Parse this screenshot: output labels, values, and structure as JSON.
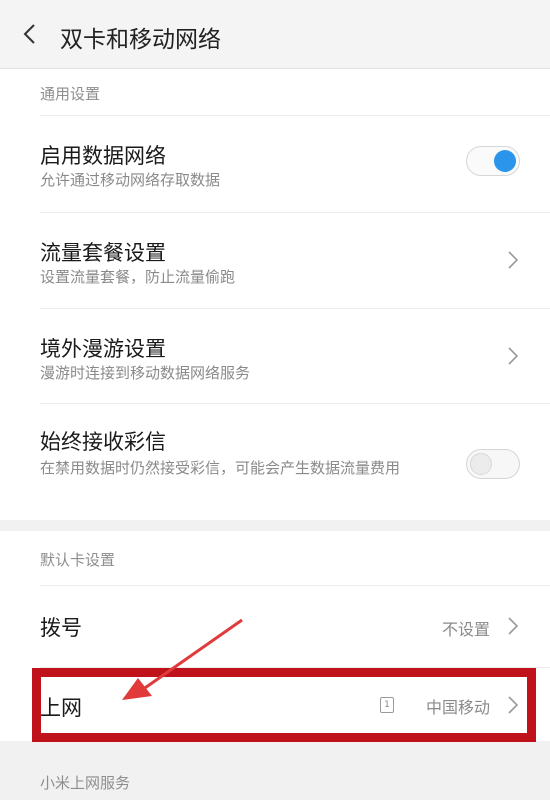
{
  "header": {
    "title": "双卡和移动网络"
  },
  "general": {
    "section_label": "通用设置",
    "items": [
      {
        "title": "启用数据网络",
        "subtitle": "允许通过移动网络存取数据",
        "control": "toggle-on"
      },
      {
        "title": "流量套餐设置",
        "subtitle": "设置流量套餐，防止流量偷跑",
        "control": "chevron"
      },
      {
        "title": "境外漫游设置",
        "subtitle": "漫游时连接到移动数据网络服务",
        "control": "chevron"
      },
      {
        "title": "始终接收彩信",
        "subtitle": "在禁用数据时仍然接受彩信，可能会产生数据流量费用",
        "control": "toggle-off"
      }
    ]
  },
  "default_card": {
    "section_label": "默认卡设置",
    "dial": {
      "title": "拨号",
      "value": "不设置"
    },
    "internet": {
      "title": "上网",
      "sim_badge": "1",
      "value": "中国移动"
    }
  },
  "xiaomi": {
    "section_label": "小米上网服务"
  },
  "colors": {
    "accent": "#2b95ec",
    "annotation": "#c0121a"
  }
}
